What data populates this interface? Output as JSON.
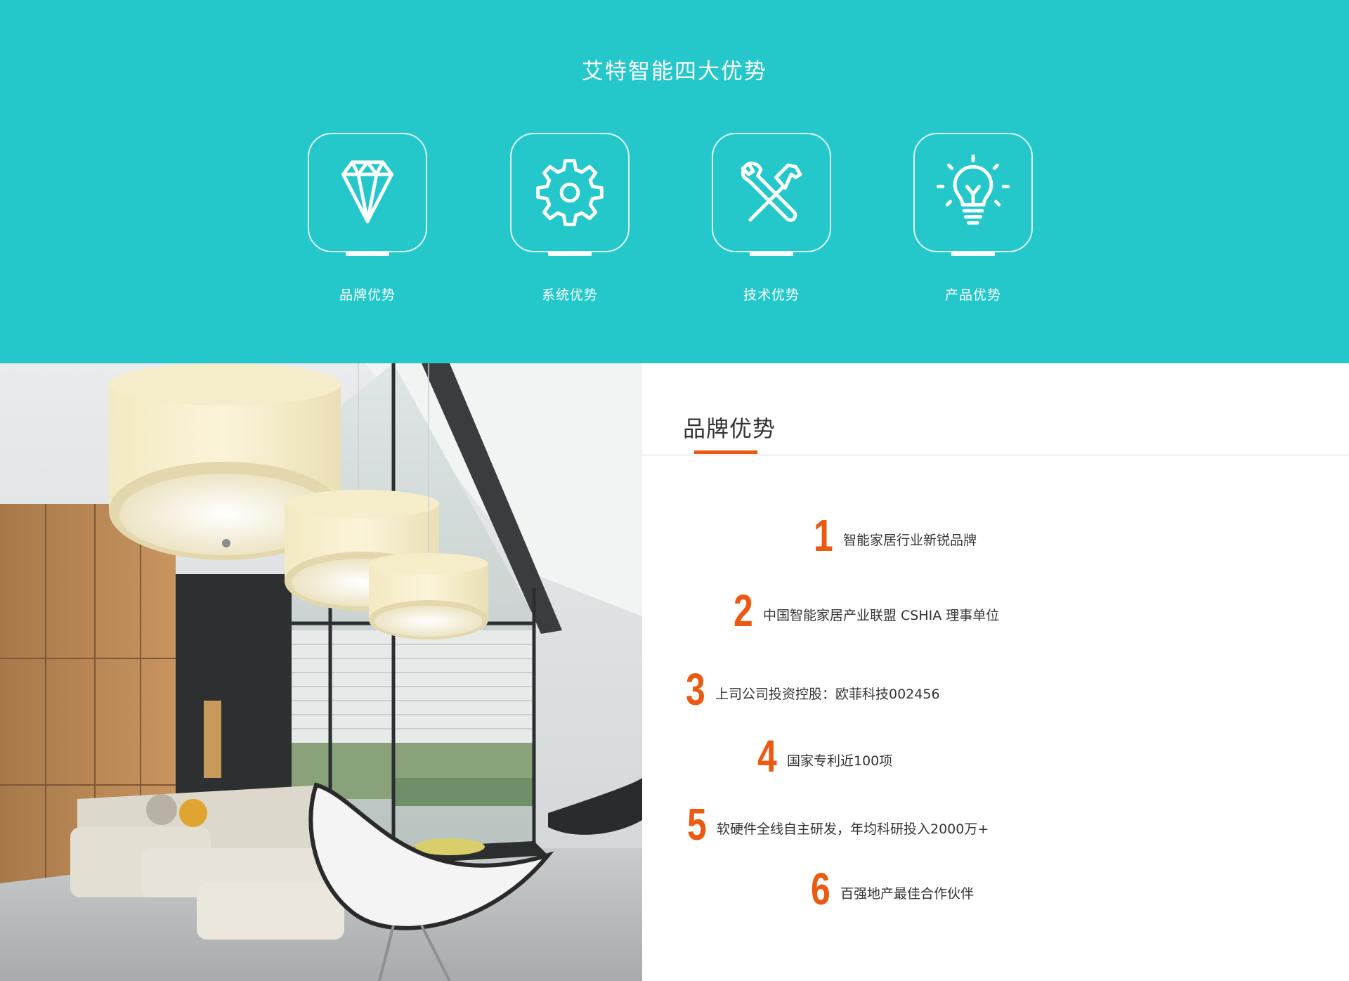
{
  "section": {
    "title": "艾特智能四大优势"
  },
  "features": [
    {
      "label": "品牌优势",
      "icon": "diamond-icon"
    },
    {
      "label": "系统优势",
      "icon": "gear-icon"
    },
    {
      "label": "技术优势",
      "icon": "wrench-hammer-icon"
    },
    {
      "label": "产品优势",
      "icon": "lightbulb-icon"
    }
  ],
  "panel": {
    "heading": "品牌优势",
    "items": [
      {
        "number": "1",
        "text": "智能家居行业新锐品牌"
      },
      {
        "number": "2",
        "text": "中国智能家居产业联盟 CSHIA 理事单位"
      },
      {
        "number": "3",
        "text": "上司公司投资控股：欧菲科技002456"
      },
      {
        "number": "4",
        "text": "国家专利近100项"
      },
      {
        "number": "5",
        "text": "软硬件全线自主研发，年均科研投入2000万+"
      },
      {
        "number": "6",
        "text": "百强地产最佳合作伙伴"
      }
    ]
  },
  "colors": {
    "teal": "#25c8ca",
    "accent": "#ea5a12",
    "text": "#333333"
  }
}
